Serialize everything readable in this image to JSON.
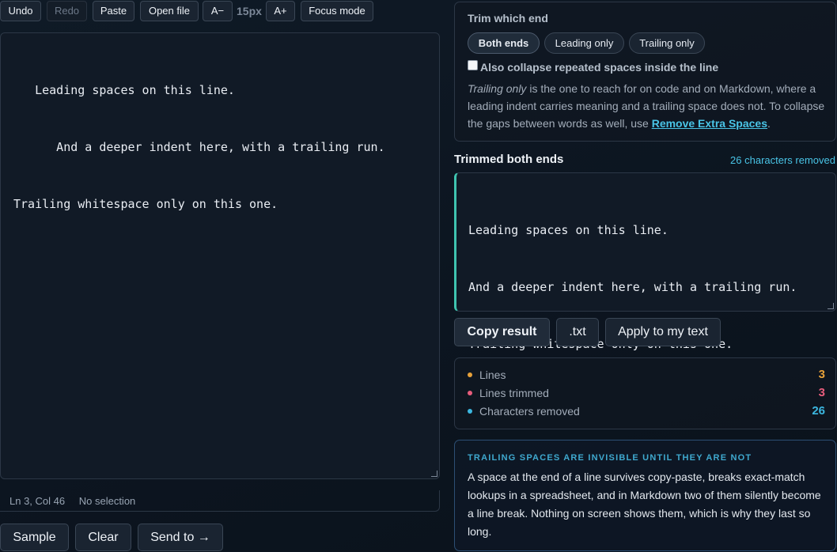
{
  "toolbar": {
    "undo": "Undo",
    "redo": "Redo",
    "paste": "Paste",
    "open_file": "Open file",
    "font_decrease": "A−",
    "font_size": "15px",
    "font_increase": "A+",
    "focus_mode": "Focus mode"
  },
  "editor": {
    "lines": [
      "   Leading spaces on this line.",
      "      And a deeper indent here, with a trailing run.   ",
      "Trailing whitespace only on this one.   "
    ]
  },
  "status": {
    "position": "Ln 3, Col 46",
    "selection": "No selection"
  },
  "actions": {
    "sample": "Sample",
    "clear": "Clear",
    "send_to": "Send to →"
  },
  "options": {
    "title": "Trim which end",
    "modes": [
      "Both ends",
      "Leading only",
      "Trailing only"
    ],
    "selected_mode": "Both ends",
    "collapse_label": "Also collapse repeated spaces inside the line",
    "collapse_checked": false,
    "desc_em": "Trailing only",
    "desc_text": " is the one to reach for on code and on Markdown, where a leading indent carries meaning and a trailing space does not. To collapse the gaps between words as well, use ",
    "desc_link": "Remove Extra Spaces",
    "desc_end": "."
  },
  "result": {
    "title": "Trimmed both ends",
    "count": "26 characters removed",
    "lines": [
      "Leading spaces on this line.",
      "And a deeper indent here, with a trailing run.",
      "Trailing whitespace only on this one."
    ]
  },
  "result_actions": {
    "copy": "Copy result",
    "txt": ".txt",
    "apply": "Apply to my text"
  },
  "stats": [
    {
      "label": "Lines",
      "value": "3",
      "color": "#e8a23a"
    },
    {
      "label": "Lines trimmed",
      "value": "3",
      "color": "#e85d7c"
    },
    {
      "label": "Characters removed",
      "value": "26",
      "color": "#3cb7e0"
    }
  ],
  "tip": {
    "title": "TRAILING SPACES ARE INVISIBLE UNTIL THEY ARE NOT",
    "body": "A space at the end of a line survives copy-paste, breaks exact-match lookups in a spreadsheet, and in Markdown two of them silently become a line break. Nothing on screen shows them, which is why they last so long."
  }
}
